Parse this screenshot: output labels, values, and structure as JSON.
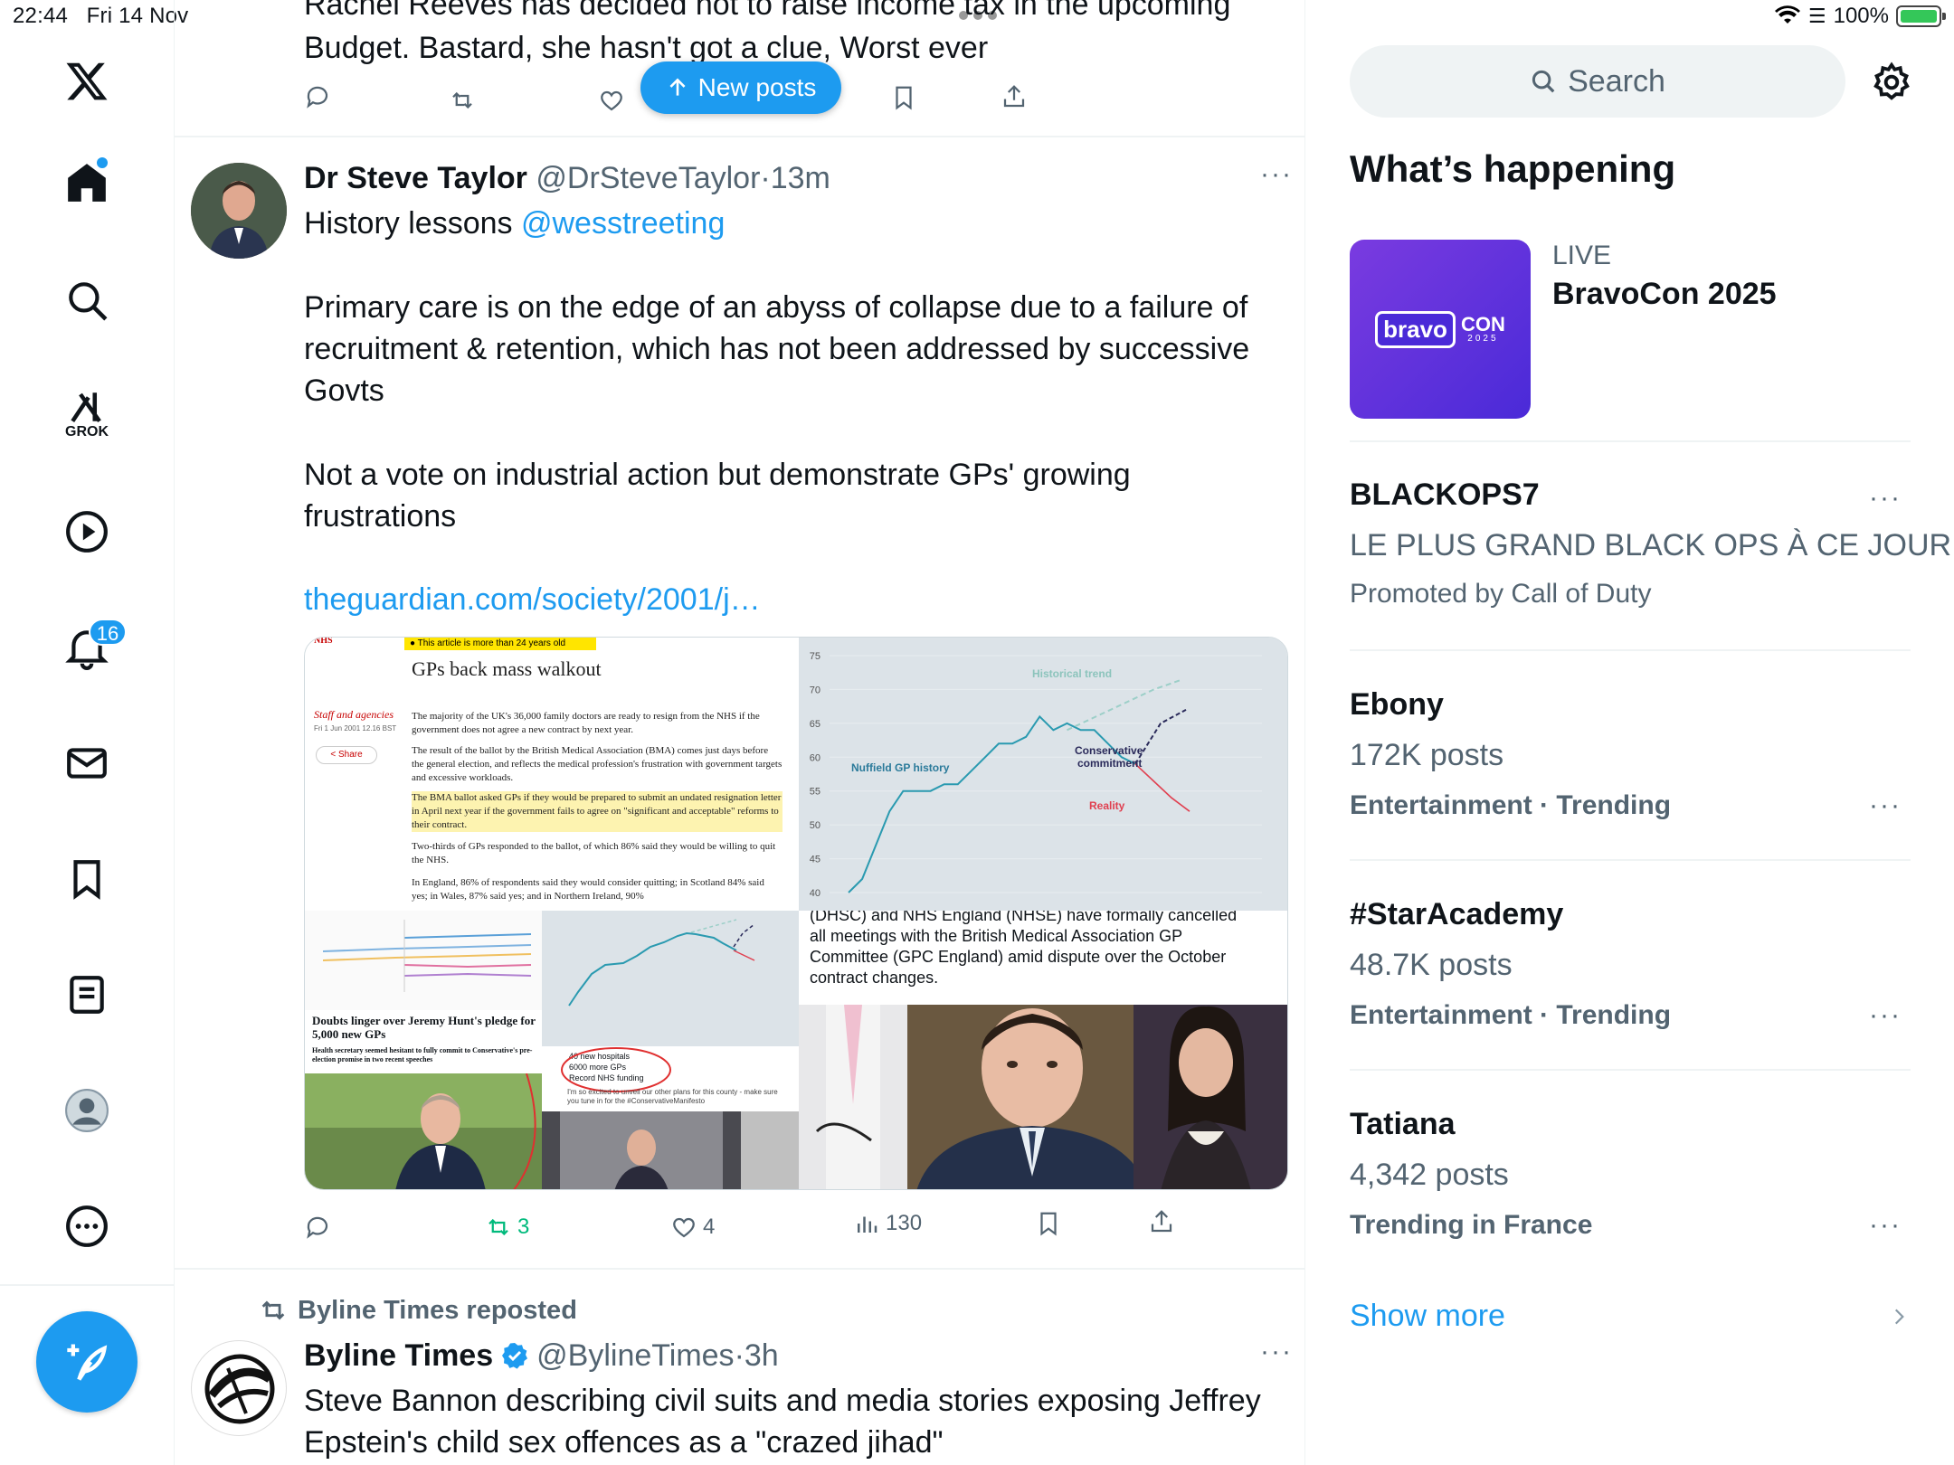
{
  "status_bar": {
    "time": "22:44",
    "date": "Fri 14 Nov",
    "battery": "100%"
  },
  "sidebar": {
    "items": [
      "x-logo",
      "home",
      "explore",
      "grok",
      "video",
      "notifications",
      "messages",
      "bookmarks",
      "lists",
      "profile",
      "more"
    ],
    "grok_label": "GROK",
    "notifications_badge": "16"
  },
  "feed": {
    "new_posts_label": "New posts",
    "prev_post": {
      "line1": "Rachel Reeves has decided not to raise income tax in the upcoming",
      "line2": "Budget. Bastard, she hasn't got a clue, Worst ever"
    },
    "post1": {
      "name": "Dr Steve Taylor",
      "handle": "@DrSteveTaylor",
      "sep": "·",
      "time": "13m",
      "line1_a": "History lessons ",
      "line1_mention": "@wesstreeting",
      "para2_l1": "Primary care is on the edge of an abyss of collapse due to a failure of",
      "para2_l2": "recruitment & retention, which has not been addressed by successive",
      "para2_l3": "Govts",
      "para3_l1": "Not a vote on industrial action but demonstrate GPs' growing",
      "para3_l2": "frustrations",
      "link": "theguardian.com/society/2001/j…",
      "retweets": "3",
      "likes": "4",
      "views": "130",
      "media": {
        "article_banner": "This article is more than 24 years old",
        "article_banner_bold": "24 years old",
        "article_title": "GPs back mass walkout",
        "byline": "Staff and agencies",
        "date": "Fri 1 Jun 2001 12.16 BST",
        "share": "Share",
        "para1": "The majority of the UK's 36,000 family doctors are ready to resign from the NHS if the government does not agree a new contract by next year.",
        "para2": "The result of the ballot by the British Medical Association (BMA) comes just days before the general election, and reflects the medical profession's frustration with government targets and excessive workloads.",
        "para3": "The BMA ballot asked GPs if they would be prepared to submit an undated resignation letter in April next year if the government fails to agree on \"significant and acceptable\" reforms to their contract.",
        "para4": "Two-thirds of GPs responded to the ballot, of which 86% said they would be willing to quit the NHS.",
        "para5": "In England, 86% of respondents said they would consider quitting; in Scotland 84% said yes; in Wales, 87% said yes; and in Northern Ireland, 90%",
        "nhs_label": "NHS",
        "chart_labels": {
          "history": "Nuffield GP history",
          "trend": "Historical trend",
          "conservative": "Conservative commitment",
          "reality": "Reality"
        },
        "hunt_title": "Doubts linger over Jeremy Hunt's pledge for 5,000 new GPs",
        "hunt_sub": "Health secretary seemed hesitant to fully commit to Conservative's pre-election promise in two recent speeches",
        "manifesto_l1": "40 new hospitals",
        "manifesto_l2": "6000 more GPs",
        "manifesto_l3": "Record NHS funding",
        "manifesto_l4": "I'm so excited to unveil our other plans for this county - make sure you tune in for the #ConservativeManifesto",
        "dhsc_l1": "(DHSC) and NHS England (NHSE) have formally cancelled",
        "dhsc_l2": "all meetings with the British Medical Association GP",
        "dhsc_l3": "Committee (GPC England) amid dispute over the October",
        "dhsc_l4": "contract changes."
      }
    },
    "post2": {
      "reposted_by": "Byline Times reposted",
      "name": "Byline Times",
      "handle": "@BylineTimes",
      "sep": "·",
      "time": "3h",
      "line1": "Steve Bannon describing civil suits and media stories exposing Jeffrey",
      "line2": "Epstein's child sex offences as a \"crazed jihad\""
    }
  },
  "chart_data": {
    "type": "line",
    "ylim": [
      40,
      75
    ],
    "yticks": [
      40,
      45,
      50,
      55,
      60,
      65,
      70,
      75
    ],
    "series": [
      {
        "name": "Nuffield GP history",
        "values": [
          40,
          42,
          47,
          52,
          55,
          55,
          55,
          56,
          56,
          58,
          60,
          62,
          62,
          63,
          66,
          64,
          65,
          64,
          64,
          62,
          60,
          59
        ]
      },
      {
        "name": "Historical trend",
        "values": [
          64,
          66,
          68,
          70,
          71.5
        ]
      },
      {
        "name": "Conservative commitment",
        "values": [
          59,
          62,
          65,
          66,
          67
        ]
      },
      {
        "name": "Reality",
        "values": [
          59,
          56.5,
          54,
          52
        ]
      }
    ]
  },
  "right": {
    "search_placeholder": "Search",
    "whats_happening": "What’s happening",
    "live": {
      "label": "LIVE",
      "title": "BravoCon 2025",
      "logo_left": "bravo",
      "logo_right": "CON",
      "logo_year": "2025"
    },
    "trends": [
      {
        "title": "BLACKOPS7",
        "sub": "LE PLUS GRAND BLACK OPS À CE JOUR",
        "meta": "Promoted by Call of Duty"
      },
      {
        "title": "Ebony",
        "sub": "172K posts",
        "meta": "Entertainment · Trending"
      },
      {
        "title": "#StarAcademy",
        "sub": "48.7K posts",
        "meta": "Entertainment · Trending"
      },
      {
        "title": "Tatiana",
        "sub": "4,342 posts",
        "meta": "Trending in France"
      }
    ],
    "show_more": "Show more"
  }
}
